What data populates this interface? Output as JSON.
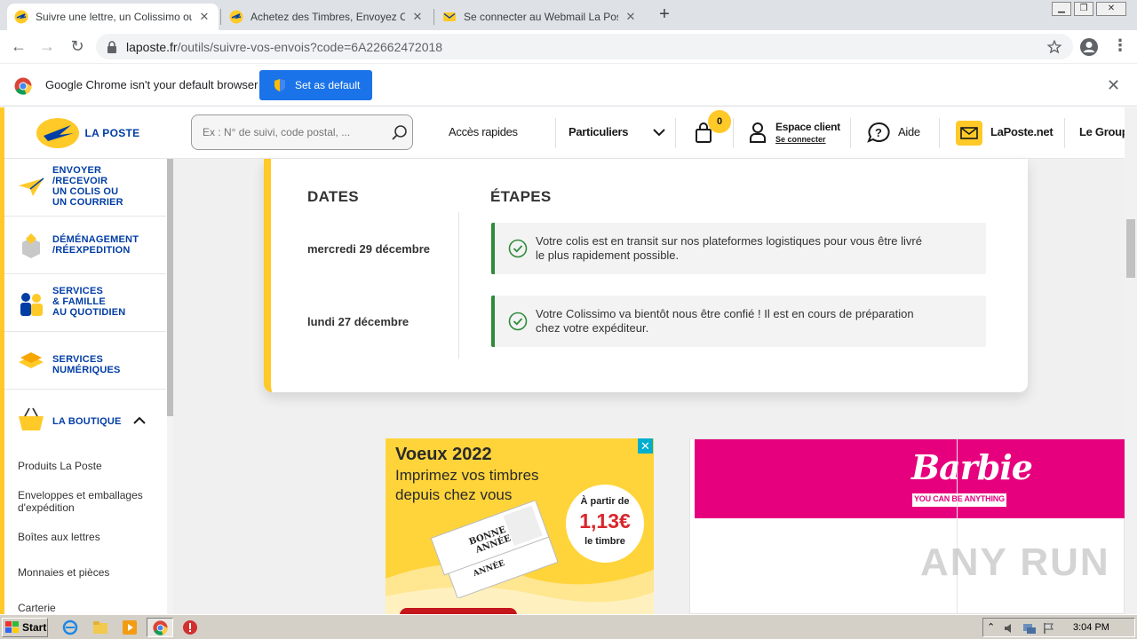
{
  "browser": {
    "tabs": [
      {
        "title": "Suivre une lettre, un Colissimo ou un",
        "active": true
      },
      {
        "title": "Achetez des Timbres, Envoyez Cour",
        "active": false
      },
      {
        "title": "Se connecter au Webmail La Poste –",
        "active": false
      }
    ],
    "new_tab_symbol": "+",
    "url_host": "laposte.fr",
    "url_path": "/outils/suivre-vos-envois?code=6A22662472018"
  },
  "infobar": {
    "message": "Google Chrome isn't your default browser",
    "button_label": "Set as default"
  },
  "site": {
    "logo_text": "LA POSTE",
    "search_placeholder": "Ex : N° de suivi, code postal, ...",
    "nav": {
      "acces_rapides": "Accès rapides",
      "particuliers": "Particuliers",
      "cart_count": "0",
      "espace_client": "Espace client",
      "espace_client_sub": "Se connecter",
      "aide": "Aide",
      "laposte_net": "LaPoste.net",
      "le_groupe": "Le Group"
    }
  },
  "sidebar": {
    "items": [
      {
        "lines": [
          "ENVOYER",
          "/RECEVOIR",
          "UN COLIS OU",
          "UN COURRIER"
        ]
      },
      {
        "lines": [
          "DÉMÉNAGEMENT",
          "/RÉEXPEDITION"
        ]
      },
      {
        "lines": [
          "SERVICES",
          "& FAMILLE",
          "AU QUOTIDIEN"
        ]
      },
      {
        "lines": [
          "SERVICES",
          "NUMÉRIQUES"
        ]
      },
      {
        "lines": [
          "LA BOUTIQUE"
        ]
      }
    ],
    "boutique_sub": [
      [
        "Produits La Poste"
      ],
      [
        "Enveloppes et emballages",
        "d'expédition"
      ],
      [
        "Boîtes aux lettres"
      ],
      [
        "Monnaies et pièces"
      ],
      [
        "Carterie"
      ]
    ]
  },
  "tracking": {
    "col_dates": "DATES",
    "col_etapes": "ÉTAPES",
    "events": [
      {
        "date": "mercredi 29 décembre",
        "lines": [
          "Votre colis est en transit sur nos plateformes logistiques pour vous être livré",
          "le plus rapidement possible."
        ]
      },
      {
        "date": "lundi 27 décembre",
        "lines": [
          "Votre Colissimo va bientôt nous être confié ! Il est en cours de préparation",
          "chez votre expéditeur."
        ]
      }
    ]
  },
  "ads": {
    "voeux": {
      "title": "Voeux 2022",
      "subtitle_lines": [
        "Imprimez vos timbres",
        "depuis chez vous"
      ],
      "price_prefix": "À partir de",
      "price": "1,13€",
      "price_suffix": "le timbre",
      "stamp_text_1": "BONNE",
      "stamp_text_2": "ANNÉE",
      "stamp_text_3": "ANNÉE"
    },
    "barbie": {
      "brand": "Barbie",
      "tagline": "YOU CAN BE ANYTHING"
    }
  },
  "watermark": "ANY RUN",
  "taskbar": {
    "start_label": "Start",
    "clock": "3:04 PM"
  },
  "colors": {
    "laposte_yellow": "#ffc928",
    "laposte_blue": "#003da5",
    "chrome_blue": "#1a73e8",
    "step_green": "#2e8b3a",
    "barbie_pink": "#e6007e"
  }
}
